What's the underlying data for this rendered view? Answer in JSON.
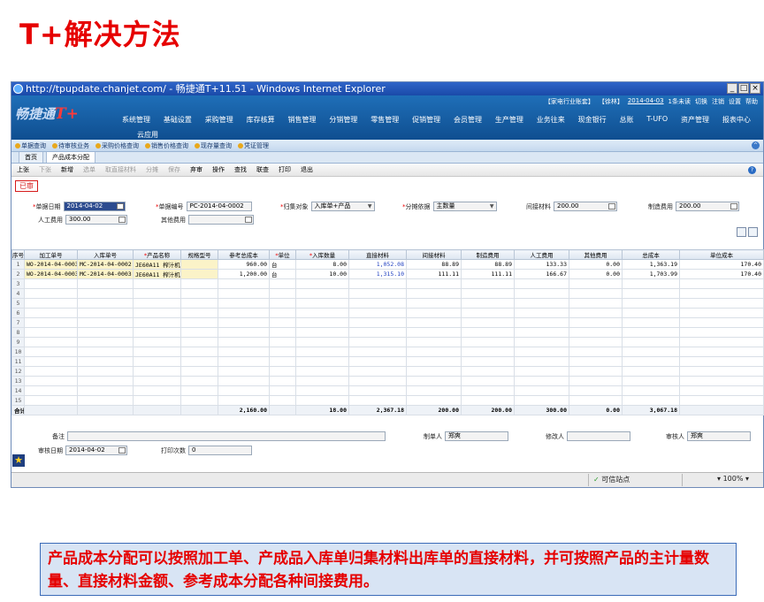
{
  "slide": {
    "title": "T+解决方法",
    "caption": "产品成本分配可以按照加工单、产成品入库单归集材料出库单的直接材料，并可按照产品的主计量数量、直接材料金额、参考成本分配各种间接费用。"
  },
  "browser": {
    "title": "http://tpupdate.chanjet.com/ - 畅捷通T+11.51 - Windows Internet Explorer",
    "status_trusted": "可信站点",
    "zoom": "100%"
  },
  "app": {
    "logo_text": "畅捷通",
    "logo_mark": "T+",
    "toplinks": [
      "【家电行业账套】",
      "【徐林】",
      "2014-04-03",
      "1条未读",
      "切换",
      "注销",
      "设置",
      "帮助"
    ],
    "modules": [
      "系统管理",
      "基础设置",
      "采购管理",
      "库存核算",
      "销售管理",
      "分销管理",
      "零售管理",
      "促销管理",
      "会员管理",
      "生产管理",
      "业务往来",
      "现金银行",
      "总账",
      "T-UFO",
      "资产管理",
      "报表中心"
    ],
    "modules_row2": "云应用",
    "shortcuts": [
      "单据查询",
      "待审核业务",
      "采购价格查询",
      "销售价格查询",
      "现存量查询",
      "凭证管理"
    ],
    "tabs": [
      "首页",
      "产品成本分配"
    ],
    "toolbar": {
      "items": [
        "上张",
        "下张",
        "新增",
        "选单",
        "取直接材料",
        "分摊",
        "保存",
        "弃审",
        "操作",
        "查找",
        "联查",
        "打印",
        "退出"
      ],
      "disabled": [
        false,
        true,
        false,
        true,
        true,
        true,
        true,
        false,
        false,
        false,
        false,
        false,
        false
      ]
    }
  },
  "form": {
    "stamp": "已审",
    "doc_date_label": "单据日期",
    "doc_date": "2014-04-02",
    "doc_no_label": "单据编号",
    "doc_no": "PC-2014-04-0002",
    "collect_label": "归集对象",
    "collect": "入库单+产品",
    "alloc_basis_label": "分摊依据",
    "alloc_basis": "主数量",
    "indirect_label": "间接材料",
    "indirect": "200.00",
    "mfg_label": "制造费用",
    "mfg": "200.00",
    "labor_label": "人工费用",
    "labor": "300.00",
    "other_label": "其他费用",
    "other": ""
  },
  "table": {
    "headers": [
      "序号",
      "加工单号",
      "入库单号",
      "产品名称",
      "规格型号",
      "参考总成本",
      "单位",
      "入库数量",
      "直接材料",
      "间接材料",
      "制造费用",
      "人工费用",
      "其他费用",
      "总成本",
      "单位成本"
    ],
    "required": [
      false,
      false,
      false,
      true,
      false,
      false,
      true,
      true,
      false,
      false,
      false,
      false,
      false,
      false,
      false
    ],
    "rows": [
      [
        "1",
        "WO-2014-04-0003",
        "MC-2014-04-0002",
        "JE60A11 榨汁机",
        "",
        "960.00",
        "台",
        "8.00",
        "1,052.08",
        "88.89",
        "88.89",
        "133.33",
        "0.00",
        "1,363.19",
        "170.40"
      ],
      [
        "2",
        "WO-2014-04-0003",
        "MC-2014-04-0003",
        "JE60A11 榨汁机",
        "",
        "1,200.00",
        "台",
        "10.00",
        "1,315.10",
        "111.11",
        "111.11",
        "166.67",
        "0.00",
        "1,703.99",
        "170.40"
      ]
    ],
    "empty_row_numbers": [
      "3",
      "4",
      "5",
      "6",
      "7",
      "8",
      "9",
      "10",
      "11",
      "12",
      "13",
      "14",
      "15"
    ],
    "total": [
      "合计",
      "",
      "",
      "",
      "",
      "2,160.00",
      "",
      "18.00",
      "2,367.18",
      "200.00",
      "200.00",
      "300.00",
      "0.00",
      "3,067.18",
      ""
    ]
  },
  "footer": {
    "remark_label": "备注",
    "remark": "",
    "maker_label": "制单人",
    "maker": "郑爽",
    "modifier_label": "修改人",
    "modifier": "",
    "auditor_label": "审核人",
    "auditor": "郑爽",
    "audit_date_label": "审核日期",
    "audit_date": "2014-04-02",
    "print_count_label": "打印次数",
    "print_count": "0"
  }
}
